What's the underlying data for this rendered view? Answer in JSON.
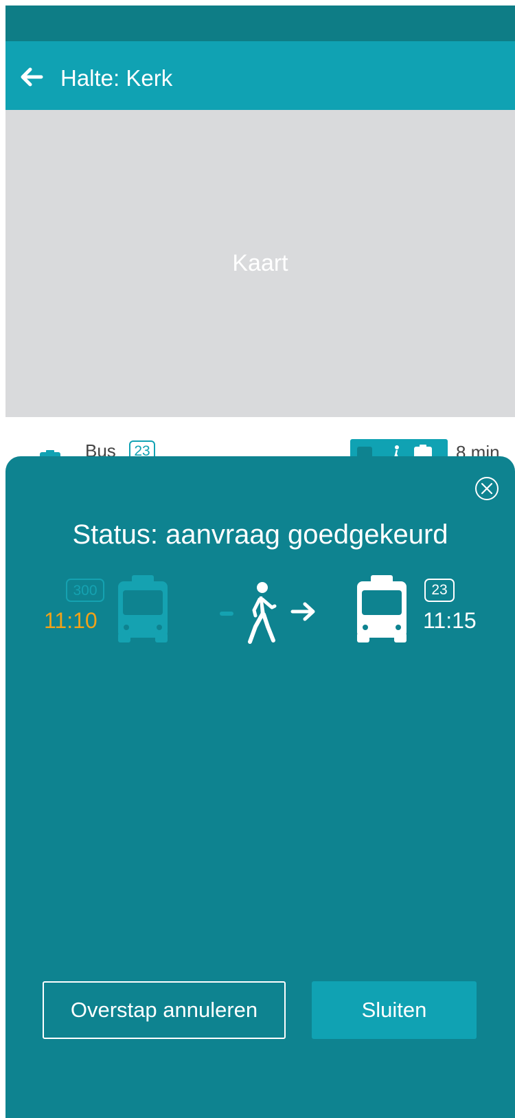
{
  "app_bar": {
    "title": "Halte: Kerk"
  },
  "map": {
    "label": "Kaart"
  },
  "list_item": {
    "type": "Bus",
    "line": "23",
    "duration": "8 min"
  },
  "sheet": {
    "title": "Status: aanvraag goedgekeurd",
    "from": {
      "line": "300",
      "time": "11:10"
    },
    "to": {
      "line": "23",
      "time": "11:15"
    },
    "cancel_label": "Overstap annuleren",
    "close_label": "Sluiten"
  },
  "icons": {
    "back": "arrow-left-icon",
    "close": "close-circle-icon",
    "bus": "bus-icon",
    "walk": "walking-person-icon",
    "arrow": "arrow-right-icon"
  },
  "colors": {
    "app_bar": "#10a2b3",
    "status_bar": "#0e7d86",
    "sheet": "#0e8390",
    "accent_time": "#f0a21a"
  }
}
